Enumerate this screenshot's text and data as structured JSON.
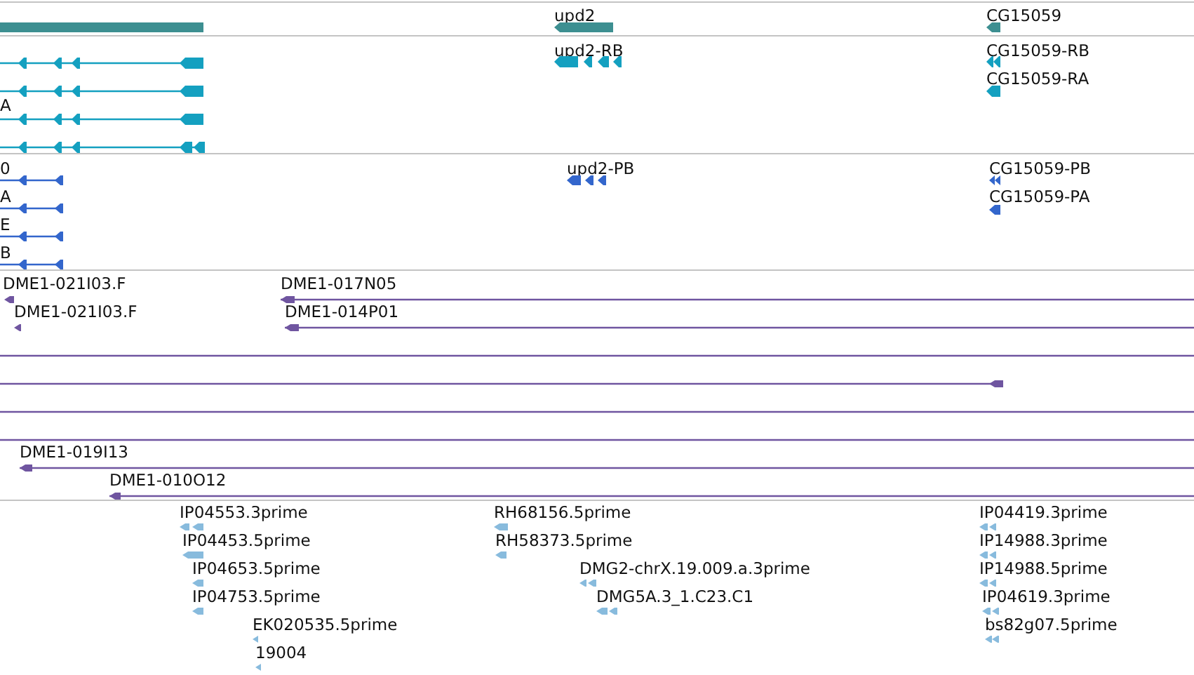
{
  "tracks": [
    {
      "kind": "gene",
      "labels": [
        "upd2",
        "CG15059"
      ]
    },
    {
      "kind": "transcript",
      "labels": [
        "A",
        "upd2-RB",
        "CG15059-RB",
        "CG15059-RA"
      ]
    },
    {
      "kind": "protein",
      "labels": [
        "0",
        "A",
        "E",
        "B",
        "upd2-PB",
        "CG15059-PB",
        "CG15059-PA"
      ]
    },
    {
      "kind": "clone",
      "labels": [
        "DME1-021I03.F",
        "DME1-017N05",
        "DME1-021I03.F",
        "DME1-014P01",
        "DME1-019I13",
        "DME1-010O12"
      ]
    },
    {
      "kind": "est",
      "labels": [
        "IP04553.3prime",
        "IP04453.5prime",
        "IP04653.5prime",
        "IP04753.5prime",
        "EK020535.5prime",
        "19004",
        "RH68156.5prime",
        "RH58373.5prime",
        "DMG2-chrX.19.009.a.3prime",
        "DMG5A.3_1.C23.C1",
        "IP04419.3prime",
        "IP14988.3prime",
        "IP14988.5prime",
        "IP04619.3prime",
        "bs82g07.5prime"
      ]
    }
  ]
}
